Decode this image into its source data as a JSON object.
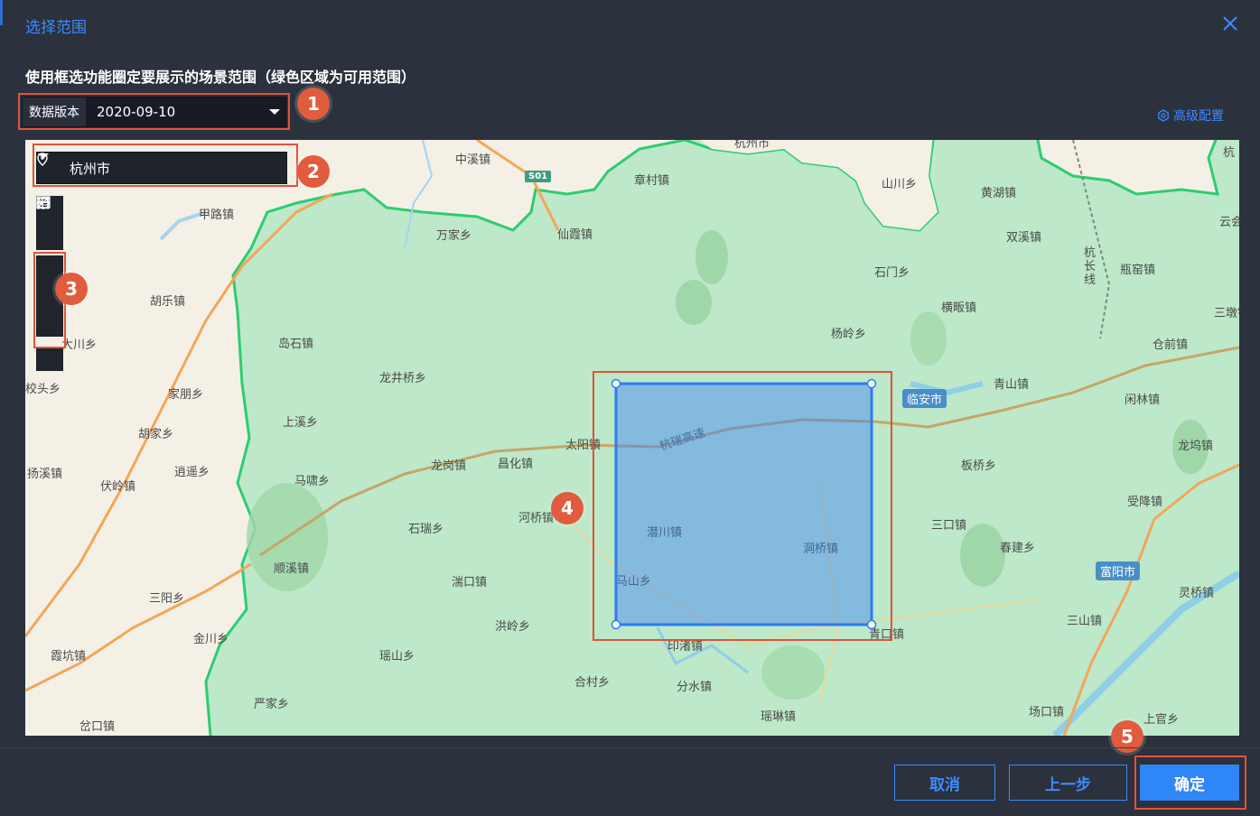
{
  "dialog": {
    "title": "选择范围",
    "instruction": "使用框选功能圈定要展示的场景范围（绿色区域为可用范围）"
  },
  "data_version": {
    "label": "数据版本",
    "value": "2020-09-10"
  },
  "advanced_link": "高级配置",
  "city_select": {
    "value": "杭州市"
  },
  "map_tools": [
    "zoom-in",
    "zoom-out",
    "rectangle-select",
    "circle-select",
    "polygon-select",
    "terminal"
  ],
  "map_places": [
    {
      "name": "杭州市",
      "style": "city"
    },
    {
      "name": "中溪镇"
    },
    {
      "name": "章村镇"
    },
    {
      "name": "山川乡"
    },
    {
      "name": "黄湖镇"
    },
    {
      "name": "甲路镇"
    },
    {
      "name": "万家乡"
    },
    {
      "name": "仙霞镇"
    },
    {
      "name": "双溪镇"
    },
    {
      "name": "石门乡"
    },
    {
      "name": "瓶窑镇"
    },
    {
      "name": "胡乐镇"
    },
    {
      "name": "横畈镇"
    },
    {
      "name": "三墩镇"
    },
    {
      "name": "岛石镇"
    },
    {
      "name": "杨岭乡"
    },
    {
      "name": "仓前镇"
    },
    {
      "name": "大川乡"
    },
    {
      "name": "龙井桥乡"
    },
    {
      "name": "青山镇"
    },
    {
      "name": "校头乡"
    },
    {
      "name": "家朋乡"
    },
    {
      "name": "闲林镇"
    },
    {
      "name": "上溪乡"
    },
    {
      "name": "太阳镇"
    },
    {
      "name": "胡家乡"
    },
    {
      "name": "龙岗镇"
    },
    {
      "name": "昌化镇"
    },
    {
      "name": "板桥乡"
    },
    {
      "name": "龙坞镇"
    },
    {
      "name": "扬溪镇"
    },
    {
      "name": "逍遥乡"
    },
    {
      "name": "马啸乡"
    },
    {
      "name": "伏岭镇"
    },
    {
      "name": "河桥镇"
    },
    {
      "name": "受降镇"
    },
    {
      "name": "石瑞乡"
    },
    {
      "name": "潜川镇"
    },
    {
      "name": "三口镇"
    },
    {
      "name": "洞桥镇"
    },
    {
      "name": "春建乡"
    },
    {
      "name": "顺溪镇"
    },
    {
      "name": "湍口镇"
    },
    {
      "name": "马山乡"
    },
    {
      "name": "三阳乡"
    },
    {
      "name": "灵桥镇"
    },
    {
      "name": "洪岭乡"
    },
    {
      "name": "三山镇"
    },
    {
      "name": "金川乡"
    },
    {
      "name": "印渚镇"
    },
    {
      "name": "青口镇"
    },
    {
      "name": "霞坑镇"
    },
    {
      "name": "瑶山乡"
    },
    {
      "name": "合村乡"
    },
    {
      "name": "分水镇"
    },
    {
      "name": "严家乡"
    },
    {
      "name": "场口镇"
    },
    {
      "name": "瑶琳镇"
    },
    {
      "name": "上官乡"
    },
    {
      "name": "岔口镇"
    },
    {
      "name": "杭长线"
    },
    {
      "name": "杭瑞高速"
    },
    {
      "name": "云会"
    },
    {
      "name": "杭"
    }
  ],
  "map_city_badges": [
    "临安市",
    "富阳市"
  ],
  "map_road_badges": [
    "S01"
  ],
  "annotations": [
    "1",
    "2",
    "3",
    "4",
    "5"
  ],
  "buttons": {
    "cancel": "取消",
    "prev": "上一步",
    "confirm": "确定"
  },
  "colors": {
    "accent": "#3d8bff",
    "primary_button": "#2f86f6",
    "available_area": "#bde8c9",
    "area_border": "#2ecc71",
    "selection": "#3b82f6",
    "annotation": "#e0533a"
  }
}
